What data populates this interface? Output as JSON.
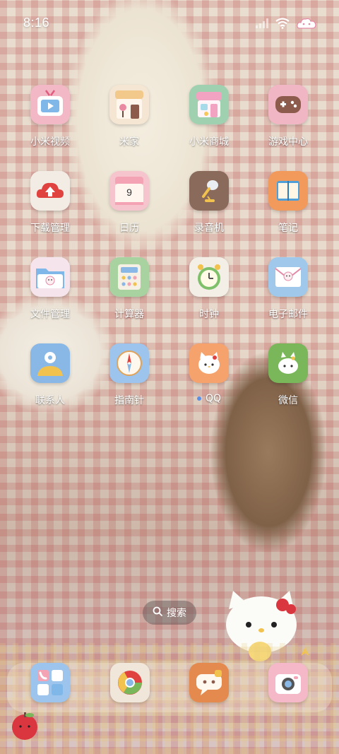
{
  "status_bar": {
    "time": "8:16",
    "icons": [
      "signal-icon",
      "wifi-icon",
      "cloud-battery-icon"
    ]
  },
  "apps": [
    {
      "label": "小米视频",
      "icon": "video-tv-icon",
      "color": "#f2b8c6"
    },
    {
      "label": "米家",
      "icon": "home-icon",
      "color": "#f4e6d2"
    },
    {
      "label": "小米商城",
      "icon": "store-icon",
      "color": "#9fd1b0"
    },
    {
      "label": "游戏中心",
      "icon": "gamepad-icon",
      "color": "#f0b6c4"
    },
    {
      "label": "下载管理",
      "icon": "download-icon",
      "color": "#f3ece4"
    },
    {
      "label": "日历",
      "icon": "calendar-icon",
      "color": "#f6c4cc",
      "badge": "9"
    },
    {
      "label": "录音机",
      "icon": "microphone-icon",
      "color": "#8a6a5a"
    },
    {
      "label": "笔记",
      "icon": "notes-icon",
      "color": "#f29a5c"
    },
    {
      "label": "文件管理",
      "icon": "folder-icon",
      "color": "#f6e4ec"
    },
    {
      "label": "计算器",
      "icon": "calculator-icon",
      "color": "#a8d3a0"
    },
    {
      "label": "时钟",
      "icon": "clock-icon",
      "color": "#f4efe6"
    },
    {
      "label": "电子邮件",
      "icon": "mail-icon",
      "color": "#9fc8ea"
    },
    {
      "label": "联系人",
      "icon": "contacts-icon",
      "color": "#8ab8e6"
    },
    {
      "label": "指南针",
      "icon": "compass-icon",
      "color": "#9cc4ec"
    },
    {
      "label": "QQ",
      "icon": "qq-cat-icon",
      "color": "#f5a26c",
      "dot": true
    },
    {
      "label": "微信",
      "icon": "wechat-icon",
      "color": "#7ab65a"
    }
  ],
  "search": {
    "label": "搜索",
    "icon": "search-icon"
  },
  "dock": [
    {
      "icon": "phone-icon",
      "color": "#9cc4ec"
    },
    {
      "icon": "browser-icon",
      "color": "#f0e6da"
    },
    {
      "icon": "messages-icon",
      "color": "#e58a4e"
    },
    {
      "icon": "camera-icon",
      "color": "#f4b8c8"
    }
  ]
}
